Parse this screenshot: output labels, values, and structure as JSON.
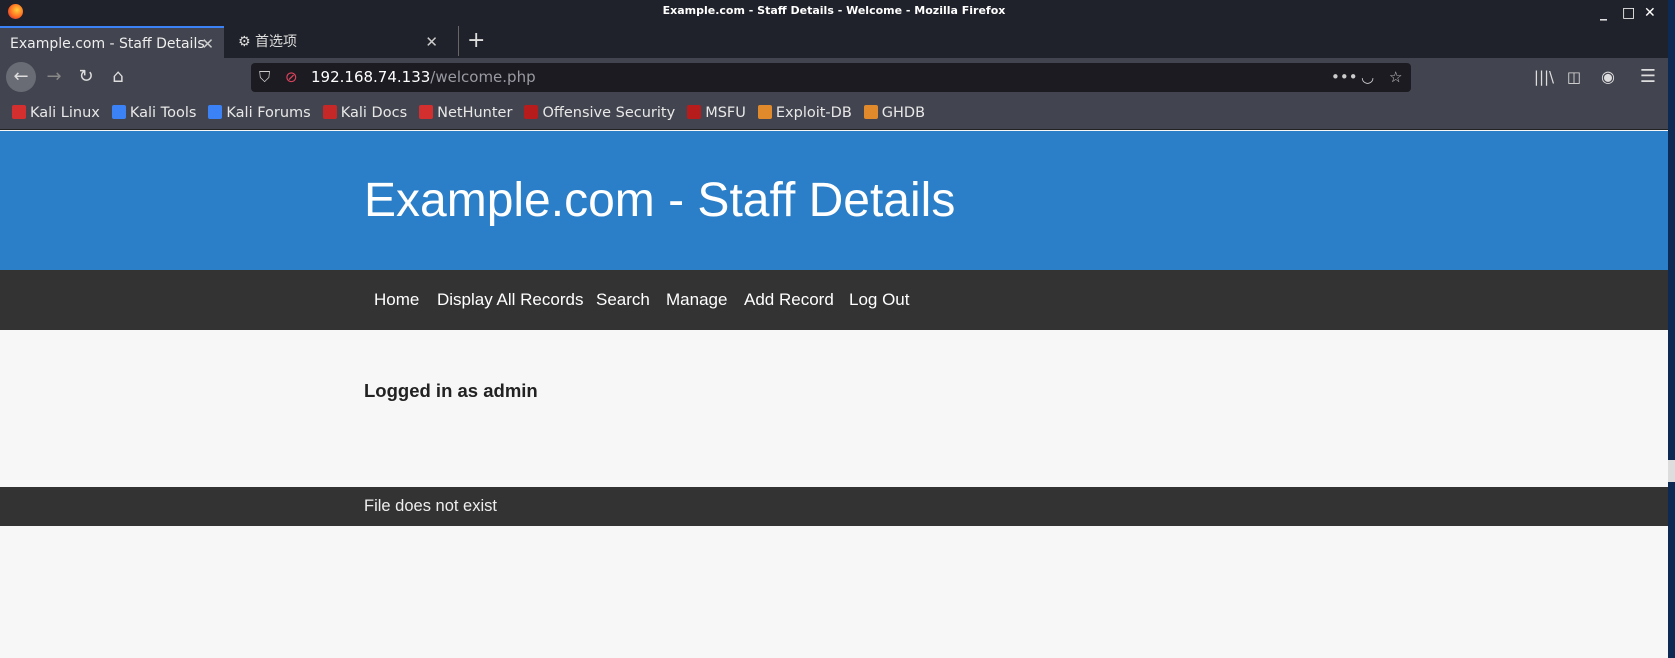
{
  "window": {
    "title": "Example.com - Staff Details - Welcome - Mozilla Firefox"
  },
  "tabs": [
    {
      "label": "Example.com - Staff Details",
      "active": true
    },
    {
      "label": "首选项",
      "icon": "gear-icon"
    }
  ],
  "address": {
    "host": "192.168.74.133",
    "path": "/welcome.php"
  },
  "bookmarks": [
    {
      "label": "Kali Linux",
      "color": "#d32f2f"
    },
    {
      "label": "Kali Tools",
      "color": "#3b82f6"
    },
    {
      "label": "Kali Forums",
      "color": "#3b82f6"
    },
    {
      "label": "Kali Docs",
      "color": "#c62828"
    },
    {
      "label": "NetHunter",
      "color": "#d32f2f"
    },
    {
      "label": "Offensive Security",
      "color": "#b71c1c"
    },
    {
      "label": "MSFU",
      "color": "#b71c1c"
    },
    {
      "label": "Exploit-DB",
      "color": "#e08a2c"
    },
    {
      "label": "GHDB",
      "color": "#e08a2c"
    }
  ],
  "site": {
    "title": "Example.com - Staff Details",
    "nav": [
      "Home",
      "Display All Records",
      "Search",
      "Manage",
      "Add Record",
      "Log Out"
    ],
    "message": "Logged in as admin",
    "footer": "File does not exist",
    "colors": {
      "header": "#2b7fc8",
      "nav": "#333333"
    }
  }
}
